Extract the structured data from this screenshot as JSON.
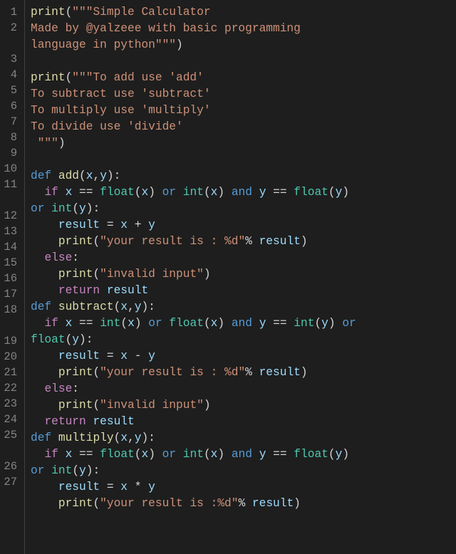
{
  "editor": {
    "lines": [
      {
        "num": "1",
        "tokens": [
          {
            "t": "print",
            "c": "fn"
          },
          {
            "t": "(",
            "c": "pun"
          },
          {
            "t": "\"\"\"Simple Calculator",
            "c": "str"
          }
        ]
      },
      {
        "num": "2",
        "tokens": [
          {
            "t": "Made by @yalzeee with basic programming ",
            "c": "str"
          }
        ]
      },
      {
        "num": "",
        "tokens": [
          {
            "t": "language in python\"\"\"",
            "c": "str"
          },
          {
            "t": ")",
            "c": "pun"
          }
        ]
      },
      {
        "num": "3",
        "tokens": []
      },
      {
        "num": "4",
        "tokens": [
          {
            "t": "print",
            "c": "fn"
          },
          {
            "t": "(",
            "c": "pun"
          },
          {
            "t": "\"\"\"To add use 'add'",
            "c": "str"
          }
        ]
      },
      {
        "num": "5",
        "tokens": [
          {
            "t": "To subtract use 'subtract'",
            "c": "str"
          }
        ]
      },
      {
        "num": "6",
        "tokens": [
          {
            "t": "To multiply use 'multiply'",
            "c": "str"
          }
        ]
      },
      {
        "num": "7",
        "tokens": [
          {
            "t": "To divide use 'divide'",
            "c": "str"
          }
        ]
      },
      {
        "num": "8",
        "tokens": [
          {
            "t": " \"\"\"",
            "c": "str"
          },
          {
            "t": ")",
            "c": "pun"
          }
        ]
      },
      {
        "num": "9",
        "tokens": []
      },
      {
        "num": "10",
        "tokens": [
          {
            "t": "def",
            "c": "def"
          },
          {
            "t": " ",
            "c": "op"
          },
          {
            "t": "add",
            "c": "fn"
          },
          {
            "t": "(",
            "c": "pun"
          },
          {
            "t": "x",
            "c": "id"
          },
          {
            "t": ",",
            "c": "pun"
          },
          {
            "t": "y",
            "c": "id"
          },
          {
            "t": "):",
            "c": "pun"
          }
        ]
      },
      {
        "num": "11",
        "tokens": [
          {
            "t": "  ",
            "c": "op"
          },
          {
            "t": "if",
            "c": "kw"
          },
          {
            "t": " x ",
            "c": "id"
          },
          {
            "t": "==",
            "c": "op"
          },
          {
            "t": " ",
            "c": "op"
          },
          {
            "t": "float",
            "c": "type"
          },
          {
            "t": "(",
            "c": "pun"
          },
          {
            "t": "x",
            "c": "id"
          },
          {
            "t": ") ",
            "c": "pun"
          },
          {
            "t": "or",
            "c": "def"
          },
          {
            "t": " ",
            "c": "op"
          },
          {
            "t": "int",
            "c": "type"
          },
          {
            "t": "(",
            "c": "pun"
          },
          {
            "t": "x",
            "c": "id"
          },
          {
            "t": ") ",
            "c": "pun"
          },
          {
            "t": "and",
            "c": "def"
          },
          {
            "t": " y ",
            "c": "id"
          },
          {
            "t": "==",
            "c": "op"
          },
          {
            "t": " ",
            "c": "op"
          },
          {
            "t": "float",
            "c": "type"
          },
          {
            "t": "(",
            "c": "pun"
          },
          {
            "t": "y",
            "c": "id"
          },
          {
            "t": ") ",
            "c": "pun"
          }
        ]
      },
      {
        "num": "",
        "tokens": [
          {
            "t": "or",
            "c": "def"
          },
          {
            "t": " ",
            "c": "op"
          },
          {
            "t": "int",
            "c": "type"
          },
          {
            "t": "(",
            "c": "pun"
          },
          {
            "t": "y",
            "c": "id"
          },
          {
            "t": "):",
            "c": "pun"
          }
        ]
      },
      {
        "num": "12",
        "tokens": [
          {
            "t": "    result ",
            "c": "id"
          },
          {
            "t": "=",
            "c": "op"
          },
          {
            "t": " x ",
            "c": "id"
          },
          {
            "t": "+",
            "c": "op"
          },
          {
            "t": " y",
            "c": "id"
          }
        ]
      },
      {
        "num": "13",
        "tokens": [
          {
            "t": "    ",
            "c": "op"
          },
          {
            "t": "print",
            "c": "fn"
          },
          {
            "t": "(",
            "c": "pun"
          },
          {
            "t": "\"your result is : %d\"",
            "c": "str"
          },
          {
            "t": "%",
            "c": "op"
          },
          {
            "t": " result",
            "c": "id"
          },
          {
            "t": ")",
            "c": "pun"
          }
        ]
      },
      {
        "num": "14",
        "tokens": [
          {
            "t": "  ",
            "c": "op"
          },
          {
            "t": "else",
            "c": "kw"
          },
          {
            "t": ":",
            "c": "pun"
          }
        ]
      },
      {
        "num": "15",
        "tokens": [
          {
            "t": "    ",
            "c": "op"
          },
          {
            "t": "print",
            "c": "fn"
          },
          {
            "t": "(",
            "c": "pun"
          },
          {
            "t": "\"invalid input\"",
            "c": "str"
          },
          {
            "t": ")",
            "c": "pun"
          }
        ]
      },
      {
        "num": "16",
        "tokens": [
          {
            "t": "    ",
            "c": "op"
          },
          {
            "t": "return",
            "c": "kw"
          },
          {
            "t": " result",
            "c": "id"
          }
        ]
      },
      {
        "num": "17",
        "tokens": [
          {
            "t": "def",
            "c": "def"
          },
          {
            "t": " ",
            "c": "op"
          },
          {
            "t": "subtract",
            "c": "fn"
          },
          {
            "t": "(",
            "c": "pun"
          },
          {
            "t": "x",
            "c": "id"
          },
          {
            "t": ",",
            "c": "pun"
          },
          {
            "t": "y",
            "c": "id"
          },
          {
            "t": "):",
            "c": "pun"
          }
        ]
      },
      {
        "num": "18",
        "tokens": [
          {
            "t": "  ",
            "c": "op"
          },
          {
            "t": "if",
            "c": "kw"
          },
          {
            "t": " x ",
            "c": "id"
          },
          {
            "t": "==",
            "c": "op"
          },
          {
            "t": " ",
            "c": "op"
          },
          {
            "t": "int",
            "c": "type"
          },
          {
            "t": "(",
            "c": "pun"
          },
          {
            "t": "x",
            "c": "id"
          },
          {
            "t": ") ",
            "c": "pun"
          },
          {
            "t": "or",
            "c": "def"
          },
          {
            "t": " ",
            "c": "op"
          },
          {
            "t": "float",
            "c": "type"
          },
          {
            "t": "(",
            "c": "pun"
          },
          {
            "t": "x",
            "c": "id"
          },
          {
            "t": ") ",
            "c": "pun"
          },
          {
            "t": "and",
            "c": "def"
          },
          {
            "t": " y ",
            "c": "id"
          },
          {
            "t": "==",
            "c": "op"
          },
          {
            "t": " ",
            "c": "op"
          },
          {
            "t": "int",
            "c": "type"
          },
          {
            "t": "(",
            "c": "pun"
          },
          {
            "t": "y",
            "c": "id"
          },
          {
            "t": ") ",
            "c": "pun"
          },
          {
            "t": "or",
            "c": "def"
          },
          {
            "t": " ",
            "c": "op"
          }
        ]
      },
      {
        "num": "",
        "tokens": [
          {
            "t": "float",
            "c": "type"
          },
          {
            "t": "(",
            "c": "pun"
          },
          {
            "t": "y",
            "c": "id"
          },
          {
            "t": "):",
            "c": "pun"
          }
        ]
      },
      {
        "num": "19",
        "tokens": [
          {
            "t": "    result ",
            "c": "id"
          },
          {
            "t": "=",
            "c": "op"
          },
          {
            "t": " x ",
            "c": "id"
          },
          {
            "t": "-",
            "c": "op"
          },
          {
            "t": " y",
            "c": "id"
          }
        ]
      },
      {
        "num": "20",
        "tokens": [
          {
            "t": "    ",
            "c": "op"
          },
          {
            "t": "print",
            "c": "fn"
          },
          {
            "t": "(",
            "c": "pun"
          },
          {
            "t": "\"your result is : %d\"",
            "c": "str"
          },
          {
            "t": "%",
            "c": "op"
          },
          {
            "t": " result",
            "c": "id"
          },
          {
            "t": ")",
            "c": "pun"
          }
        ]
      },
      {
        "num": "21",
        "tokens": [
          {
            "t": "  ",
            "c": "op"
          },
          {
            "t": "else",
            "c": "kw"
          },
          {
            "t": ":",
            "c": "pun"
          }
        ]
      },
      {
        "num": "22",
        "tokens": [
          {
            "t": "    ",
            "c": "op"
          },
          {
            "t": "print",
            "c": "fn"
          },
          {
            "t": "(",
            "c": "pun"
          },
          {
            "t": "\"invalid input\"",
            "c": "str"
          },
          {
            "t": ")",
            "c": "pun"
          }
        ]
      },
      {
        "num": "23",
        "tokens": [
          {
            "t": "  ",
            "c": "op"
          },
          {
            "t": "return",
            "c": "kw"
          },
          {
            "t": " result",
            "c": "id"
          }
        ]
      },
      {
        "num": "24",
        "tokens": [
          {
            "t": "def",
            "c": "def"
          },
          {
            "t": " ",
            "c": "op"
          },
          {
            "t": "multiply",
            "c": "fn"
          },
          {
            "t": "(",
            "c": "pun"
          },
          {
            "t": "x",
            "c": "id"
          },
          {
            "t": ",",
            "c": "pun"
          },
          {
            "t": "y",
            "c": "id"
          },
          {
            "t": "):",
            "c": "pun"
          }
        ]
      },
      {
        "num": "25",
        "tokens": [
          {
            "t": "  ",
            "c": "op"
          },
          {
            "t": "if",
            "c": "kw"
          },
          {
            "t": " x ",
            "c": "id"
          },
          {
            "t": "==",
            "c": "op"
          },
          {
            "t": " ",
            "c": "op"
          },
          {
            "t": "float",
            "c": "type"
          },
          {
            "t": "(",
            "c": "pun"
          },
          {
            "t": "x",
            "c": "id"
          },
          {
            "t": ") ",
            "c": "pun"
          },
          {
            "t": "or",
            "c": "def"
          },
          {
            "t": " ",
            "c": "op"
          },
          {
            "t": "int",
            "c": "type"
          },
          {
            "t": "(",
            "c": "pun"
          },
          {
            "t": "x",
            "c": "id"
          },
          {
            "t": ") ",
            "c": "pun"
          },
          {
            "t": "and",
            "c": "def"
          },
          {
            "t": " y ",
            "c": "id"
          },
          {
            "t": "==",
            "c": "op"
          },
          {
            "t": " ",
            "c": "op"
          },
          {
            "t": "float",
            "c": "type"
          },
          {
            "t": "(",
            "c": "pun"
          },
          {
            "t": "y",
            "c": "id"
          },
          {
            "t": ") ",
            "c": "pun"
          }
        ]
      },
      {
        "num": "",
        "tokens": [
          {
            "t": "or",
            "c": "def"
          },
          {
            "t": " ",
            "c": "op"
          },
          {
            "t": "int",
            "c": "type"
          },
          {
            "t": "(",
            "c": "pun"
          },
          {
            "t": "y",
            "c": "id"
          },
          {
            "t": "):",
            "c": "pun"
          }
        ]
      },
      {
        "num": "26",
        "tokens": [
          {
            "t": "    result ",
            "c": "id"
          },
          {
            "t": "=",
            "c": "op"
          },
          {
            "t": " x ",
            "c": "id"
          },
          {
            "t": "*",
            "c": "op"
          },
          {
            "t": " y",
            "c": "id"
          }
        ]
      },
      {
        "num": "27",
        "tokens": [
          {
            "t": "    ",
            "c": "op"
          },
          {
            "t": "print",
            "c": "fn"
          },
          {
            "t": "(",
            "c": "pun"
          },
          {
            "t": "\"your result is :%d\"",
            "c": "str"
          },
          {
            "t": "%",
            "c": "op"
          },
          {
            "t": " result",
            "c": "id"
          },
          {
            "t": ")",
            "c": "pun"
          }
        ]
      }
    ]
  }
}
